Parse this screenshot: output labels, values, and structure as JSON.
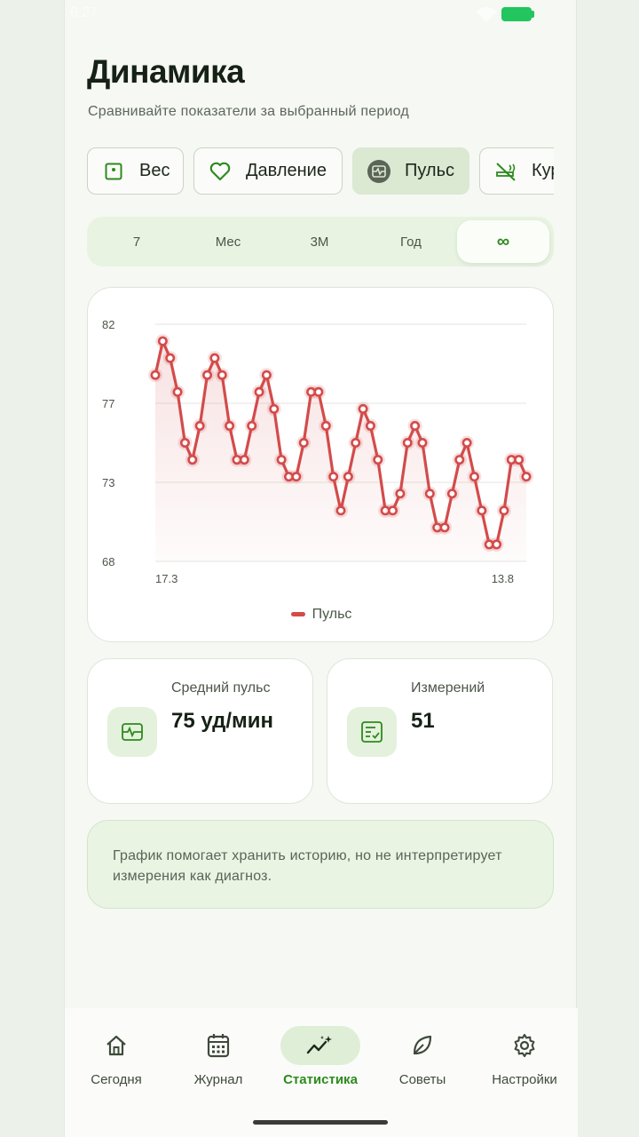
{
  "status": {
    "time": "6:27"
  },
  "header": {
    "title": "Динамика",
    "subtitle": "Сравнивайте показатели за выбранный период"
  },
  "metric_tabs": [
    {
      "label": "Вес",
      "icon": "scale-icon",
      "active": false
    },
    {
      "label": "Давление",
      "icon": "heart-icon",
      "active": false
    },
    {
      "label": "Пульс",
      "icon": "pulse-icon",
      "active": true
    },
    {
      "label": "Курение",
      "icon": "no-smoking-icon",
      "active": false
    }
  ],
  "periods": [
    {
      "label": "7",
      "active": false
    },
    {
      "label": "Мес",
      "active": false
    },
    {
      "label": "3М",
      "active": false
    },
    {
      "label": "Год",
      "active": false
    },
    {
      "label": "∞",
      "active": true
    }
  ],
  "colors": {
    "accent": "#2d8a1e",
    "series": "#d34b4b",
    "surface": "#f6f8f3"
  },
  "chart_data": {
    "type": "line",
    "title": "",
    "xlabel": "",
    "ylabel": "",
    "ylim": [
      68,
      82
    ],
    "y_ticks": [
      "82",
      "77",
      "73",
      "68"
    ],
    "x_tick_labels": [
      "17.3",
      "13.8"
    ],
    "grid": true,
    "legend_position": "bottom",
    "series": [
      {
        "name": "Пульс",
        "values": [
          79,
          81,
          80,
          78,
          75,
          74,
          76,
          79,
          80,
          79,
          76,
          74,
          74,
          76,
          78,
          79,
          77,
          74,
          73,
          73,
          75,
          78,
          78,
          76,
          73,
          71,
          73,
          75,
          77,
          76,
          74,
          71,
          71,
          72,
          75,
          76,
          75,
          72,
          70,
          70,
          72,
          74,
          75,
          73,
          71,
          69,
          69,
          71,
          74,
          74,
          73
        ]
      }
    ]
  },
  "legend": {
    "label": "Пульс"
  },
  "stats": [
    {
      "label": "Средний пульс",
      "value": "75 уд/мин",
      "icon": "pulse-icon"
    },
    {
      "label": "Измерений",
      "value": "51",
      "icon": "checklist-icon"
    }
  ],
  "note": "График помогает хранить историю, но не интерпретирует измерения как диагноз.",
  "nav": [
    {
      "label": "Сегодня",
      "icon": "home-icon",
      "active": false
    },
    {
      "label": "Журнал",
      "icon": "calendar-icon",
      "active": false
    },
    {
      "label": "Статистика",
      "icon": "trend-icon",
      "active": true
    },
    {
      "label": "Советы",
      "icon": "leaf-icon",
      "active": false
    },
    {
      "label": "Настройки",
      "icon": "gear-icon",
      "active": false
    }
  ]
}
